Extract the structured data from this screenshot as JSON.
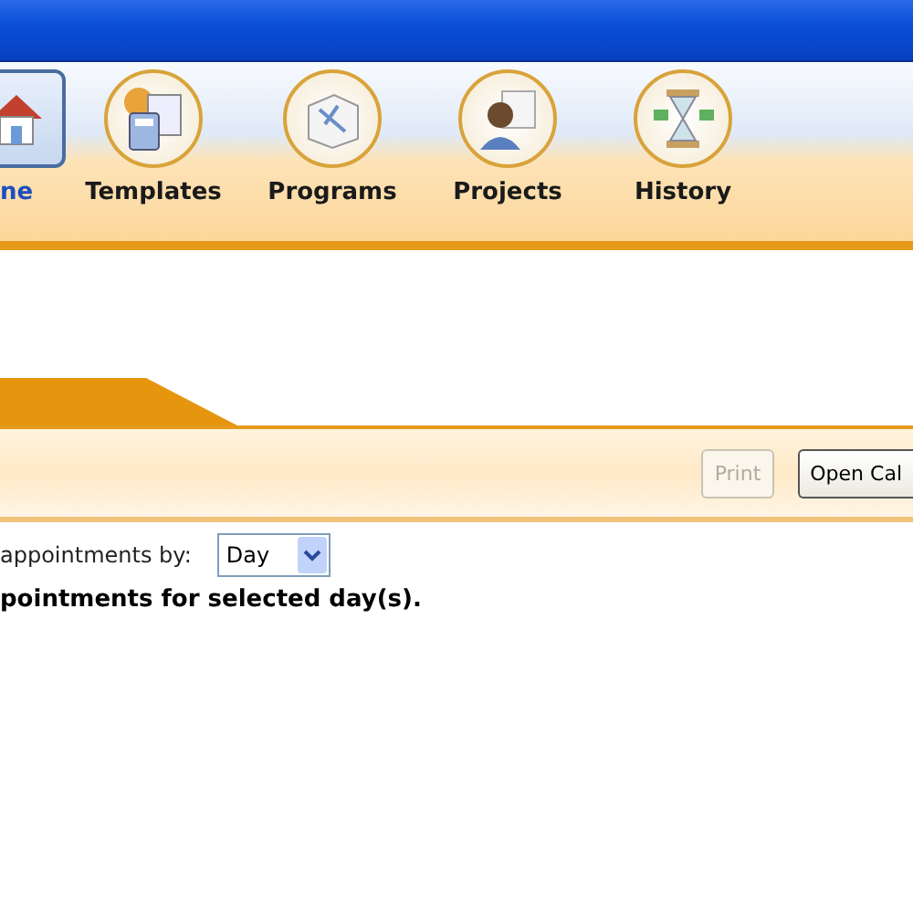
{
  "nav": {
    "items": [
      {
        "label": "ne",
        "kind": "house",
        "selected": true
      },
      {
        "label": "Templates",
        "kind": "calculator",
        "selected": false
      },
      {
        "label": "Programs",
        "kind": "box",
        "selected": false
      },
      {
        "label": "Projects",
        "kind": "person",
        "selected": false
      },
      {
        "label": "History",
        "kind": "hourglass",
        "selected": false
      }
    ]
  },
  "toolbar": {
    "buttons": [
      {
        "label": "Print",
        "disabled": true
      },
      {
        "label": "Open Cal",
        "disabled": false
      }
    ]
  },
  "filter": {
    "label": "appointments by:",
    "value": "Day"
  },
  "message": "pointments for selected day(s)."
}
